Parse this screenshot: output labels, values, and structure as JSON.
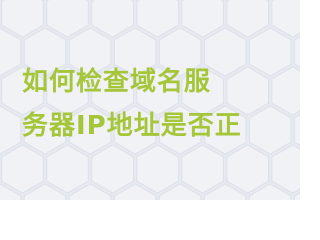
{
  "title": {
    "line1": "如何检查域名服",
    "line2": "务器IP地址是否正"
  },
  "colors": {
    "background": "#e6e9ef",
    "hex_fill": "#f0f2f6",
    "hex_stroke": "#dde1e8",
    "text": "#a6c63a"
  }
}
